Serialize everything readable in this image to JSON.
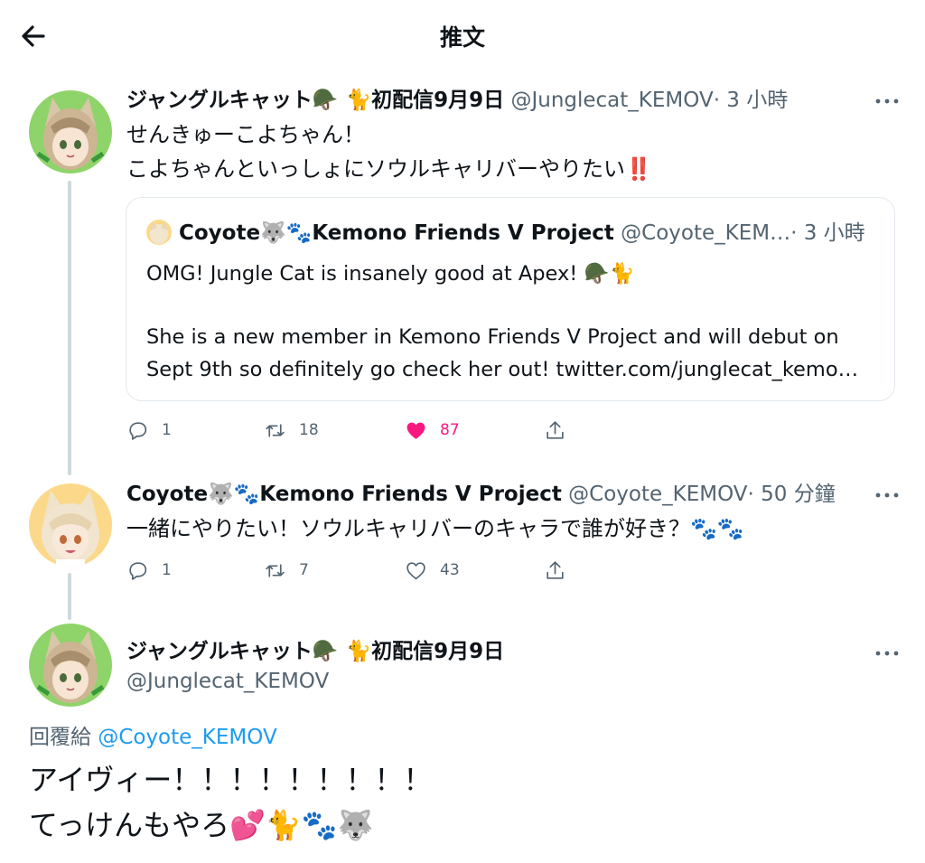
{
  "header": {
    "title": "推文"
  },
  "tweets": [
    {
      "display_name": "ジャングルキャット🪖 🐈初配信9月9日",
      "handle": "@Junglecat_KEMOV",
      "time": "· 3 小時",
      "text_lines": [
        "せんきゅーこよちゃん！",
        "こよちゃんといっしょにソウルキャリバーやりたい‼️"
      ],
      "quote": {
        "display_name": "Coyote🐺🐾Kemono Friends V Project",
        "handle": "@Coyote_KEM…",
        "time": "· 3 小時",
        "line1": "OMG! Jungle Cat is insanely good at Apex! 🪖🐈",
        "line2": "She is a new member in Kemono Friends V Project and will debut on",
        "line3": "Sept 9th so definitely go check her out! twitter.com/junglecat_kemo…"
      },
      "replies": "1",
      "retweets": "18",
      "likes": "87"
    },
    {
      "display_name": "Coyote🐺🐾Kemono Friends V Project",
      "handle": "@Coyote_KEMOV",
      "time": "· 50 分鐘",
      "text_lines": [
        "一緒にやりたい！ソウルキャリバーのキャラで誰が好き？🐾🐾"
      ],
      "replies": "1",
      "retweets": "7",
      "likes": "43"
    }
  ],
  "main_tweet": {
    "display_name": "ジャングルキャット🪖 🐈初配信9月9日",
    "handle": "@Junglecat_KEMOV",
    "reply_prefix": "回覆給",
    "reply_mention": "@Coyote_KEMOV",
    "text_lines": [
      "アイヴィー！！！！！！！！！",
      "てっけんもやろ💕🐈🐾🐺"
    ]
  },
  "colors": {
    "like_active": "#f91880",
    "mention": "#1d9bf0",
    "meta": "#536471",
    "thread_line": "#cfd9de"
  }
}
